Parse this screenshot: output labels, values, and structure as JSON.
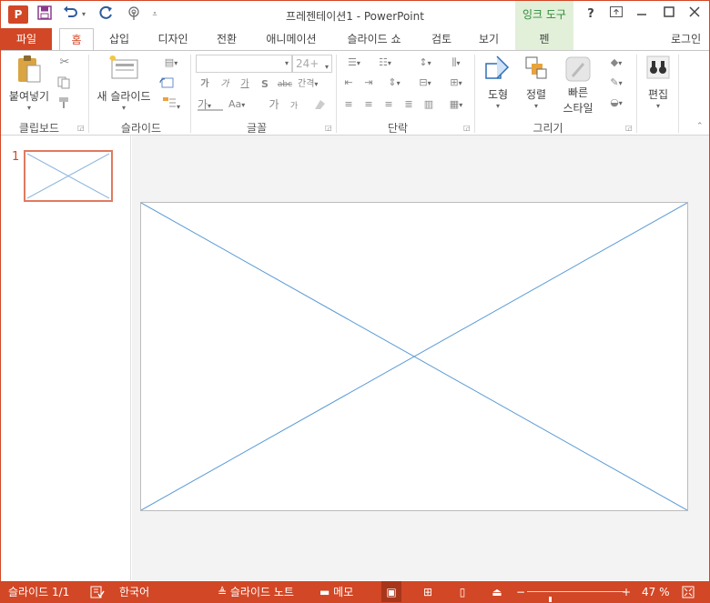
{
  "title_bar": {
    "logo": "P",
    "title": "프레젠테이션1 - PowerPoint",
    "context_group": "잉크 도구",
    "help": "?",
    "icons": [
      "powerpoint-icon",
      "save-icon",
      "undo-icon",
      "redo-icon",
      "touch-mode-icon",
      "customize-icon",
      "help-icon",
      "ribbon-display-icon",
      "minimize-icon",
      "maximize-icon",
      "close-icon"
    ]
  },
  "tabs": {
    "file": "파일",
    "home": "홈",
    "insert": "삽입",
    "design": "디자인",
    "transitions": "전환",
    "animations": "애니메이션",
    "slideshow": "슬라이드 쇼",
    "review": "검토",
    "view": "보기",
    "pen": "펜",
    "login": "로그인"
  },
  "ribbon": {
    "clipboard": {
      "paste": "붙여넣기",
      "label": "클립보드"
    },
    "slides": {
      "new_slide": "새 슬라이드",
      "label": "슬라이드"
    },
    "font": {
      "size": "24+",
      "label": "글꼴",
      "bold": "가",
      "italic": "가",
      "underline": "가",
      "shadow": "S",
      "strike": "abc",
      "spacing": "간격",
      "color": "가",
      "case": "Aa",
      "grow": "가",
      "shrink": "가"
    },
    "paragraph": {
      "label": "단락"
    },
    "drawing": {
      "shapes": "도형",
      "arrange": "정렬",
      "quick_styles_1": "빠른",
      "quick_styles_2": "스타일",
      "label": "그리기"
    },
    "editing": {
      "edit": "편집"
    }
  },
  "slide_pane": {
    "number": "1"
  },
  "status_bar": {
    "slide_info": "슬라이드 1/1",
    "language": "한국어",
    "notes": "슬라이드 노트",
    "comments": "메모",
    "zoom": "47 %",
    "zoom_level": 0.47
  },
  "colors": {
    "accent": "#d24726",
    "ink_tools": "#e2f0d9",
    "placeholder_line": "#5b9bd5"
  }
}
